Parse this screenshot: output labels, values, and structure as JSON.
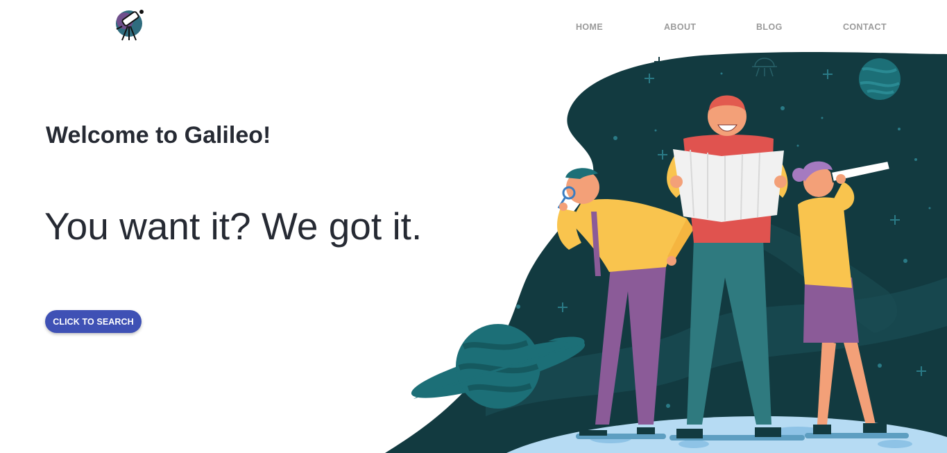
{
  "header": {
    "logo_icon": "telescope-logo-icon",
    "nav": [
      {
        "label": "HOME"
      },
      {
        "label": "ABOUT"
      },
      {
        "label": "BLOG"
      },
      {
        "label": "CONTACT"
      }
    ]
  },
  "hero": {
    "welcome": "Welcome to Galileo!",
    "tagline": "You want it? We got it.",
    "cta_label": "CLICK TO SEARCH"
  },
  "colors": {
    "primary": "#3f51b5",
    "space": "#123a40",
    "text": "#262a33",
    "nav_text": "#9a9a9a"
  }
}
